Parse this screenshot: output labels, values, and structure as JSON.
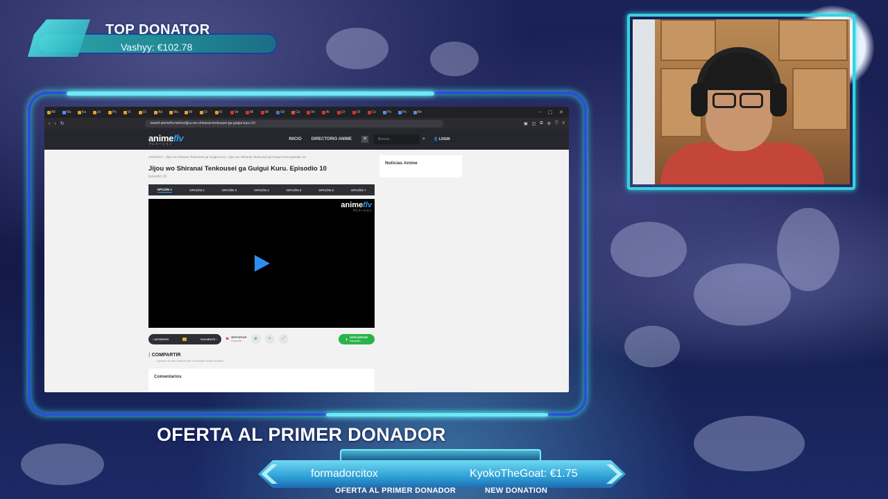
{
  "overlay": {
    "top_donator_title": "TOP DONATOR",
    "top_donator_value": "Vashyy: €102.78",
    "offer_banner": "OFERTA AL PRIMER DONADOR",
    "bar_left_name": "formadorcitox",
    "bar_right_donation": "KyokoTheGoat: €1.75",
    "bar_left_label": "OFERTA AL PRIMER DONADOR",
    "bar_right_label": "NEW DONATION",
    "accent_color": "#35d3e0",
    "frame_color": "#2c4fd6"
  },
  "browser": {
    "url": "www4.animeflv.net/ver/jijou-wo-shiranai-tenkousei-ga-guigui-kuru-10",
    "tab_count": 25
  },
  "site": {
    "logo_main": "anime",
    "logo_accent": "flv",
    "logo_sub": "アニメーション",
    "menu_home": "INICIO",
    "menu_directory": "DIRECTORIO ANIME",
    "search_placeholder": "Buscar...",
    "login": "LOGIN",
    "breadcrumb": "AnimeFLV  ›  Jijou wo Shiranai Tenkousei ga Guigui Kuru  ›  Jijou wo Shiranai Tenkousei ga Guigui Kuru Episodio 10",
    "episode_title": "Jijou wo Shiranai Tenkousei ga Guigui Kuru. Episodio 10",
    "episode_sub": "Episodio 10",
    "options": [
      "OPCIÓN 1",
      "OPCIÓN 2",
      "OPCIÓN 3",
      "OPCIÓN 4",
      "OPCIÓN 5",
      "OPCIÓN 6",
      "OPCIÓN 7"
    ],
    "prev": "ANTERIOR",
    "next": "SIGUIENTE",
    "report": "REPORTAR",
    "report_sub": "Episodio",
    "download": "DESCARGAR",
    "download_sub": "Episodio",
    "share": "COMPARTIR",
    "share_sub": "Ayuda a la web dándole like a nuestras redes sociales",
    "comments": "Comentarios",
    "news": "Noticias Anime"
  }
}
